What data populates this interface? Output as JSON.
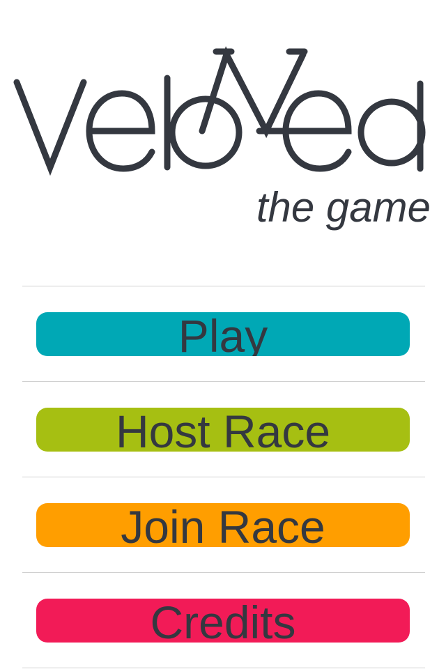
{
  "logo": {
    "word": "Vel",
    "word_end": "ed",
    "subtitle": "the game",
    "text_color": "#343840"
  },
  "menu": {
    "divider_color": "#d0d0d0",
    "buttons": [
      {
        "label": "Play",
        "color": "#00a8b5"
      },
      {
        "label": "Host Race",
        "color": "#a6bf12"
      },
      {
        "label": "Join Race",
        "color": "#ff9e00"
      },
      {
        "label": "Credits",
        "color": "#f21b57"
      }
    ]
  }
}
